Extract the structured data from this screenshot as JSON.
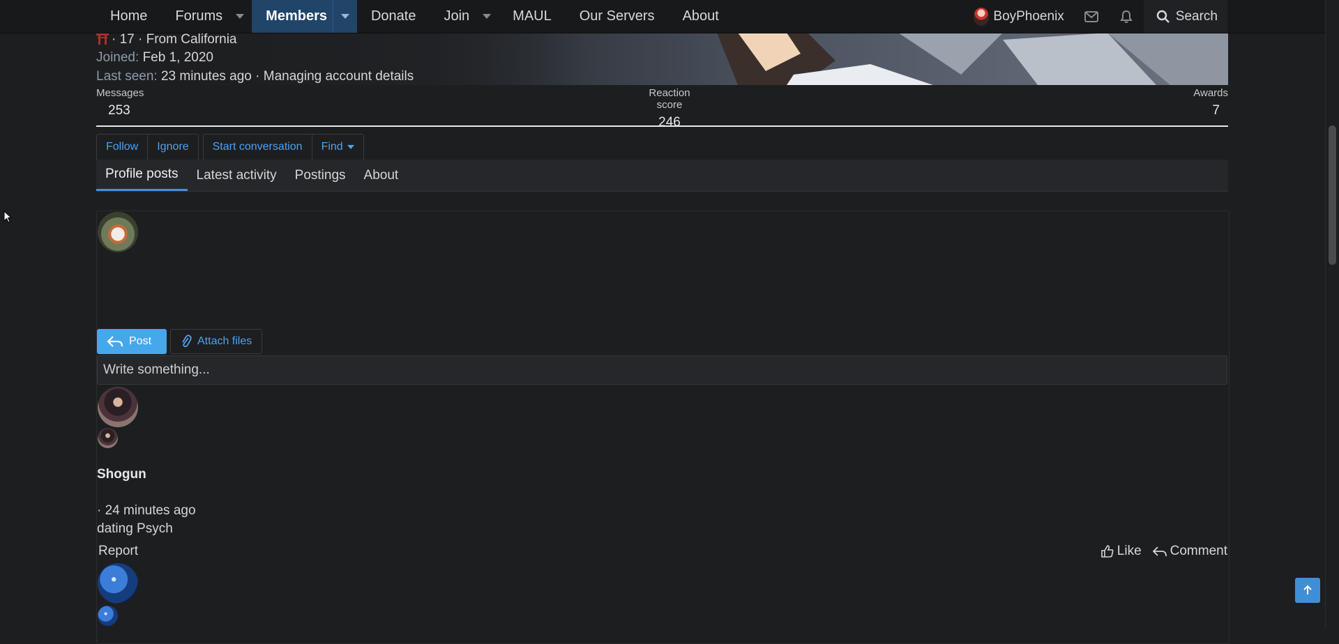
{
  "nav": {
    "home": "Home",
    "forums": "Forums",
    "members": "Members",
    "donate": "Donate",
    "join": "Join",
    "maul": "MAUL",
    "servers": "Our Servers",
    "about": "About",
    "username": "BoyPhoenix",
    "search": "Search"
  },
  "profile": {
    "age_location": "· 17 · From California",
    "joined_label": "Joined:",
    "joined_value": "Feb 1, 2020",
    "last_seen_label": "Last seen:",
    "last_seen_value": "23 minutes ago · Managing account details",
    "stats": {
      "messages_label": "Messages",
      "messages_value": "253",
      "reaction_label": "Reaction score",
      "reaction_value": "246",
      "awards_label": "Awards",
      "awards_value": "7"
    },
    "buttons": {
      "follow": "Follow",
      "ignore": "Ignore",
      "start_conversation": "Start conversation",
      "find": "Find"
    },
    "tabs": [
      "Profile posts",
      "Latest activity",
      "Postings",
      "About"
    ]
  },
  "composer": {
    "post_label": "Post",
    "attach_label": "Attach files",
    "placeholder": "Write something..."
  },
  "post": {
    "author": "Shogun",
    "time": "· 24 minutes ago",
    "message": "dating Psych",
    "report": "Report",
    "like": "Like",
    "comment": "Comment"
  },
  "colors": {
    "accent": "#47a7eb",
    "nav_active": "#214469",
    "background": "#1d1e20"
  }
}
